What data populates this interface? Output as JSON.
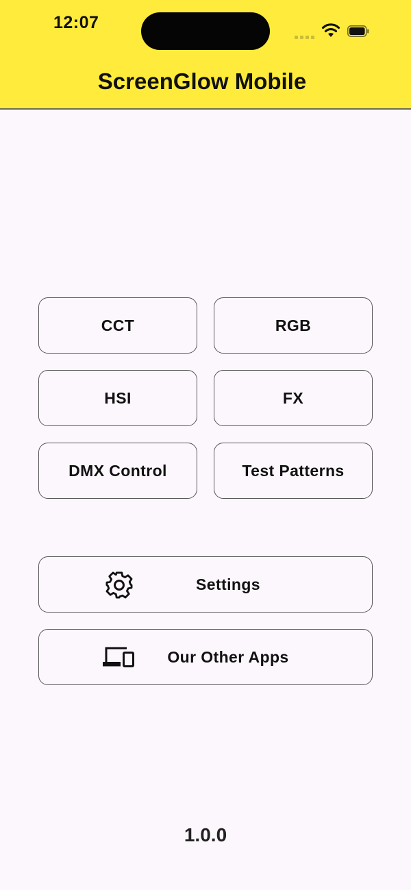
{
  "status_bar": {
    "time": "12:07",
    "icons": [
      "signal-icon",
      "wifi-icon",
      "battery-icon"
    ]
  },
  "header": {
    "title": "ScreenGlow Mobile",
    "background_color": "#ffeb3b"
  },
  "modes": [
    {
      "label": "CCT"
    },
    {
      "label": "RGB"
    },
    {
      "label": "HSI"
    },
    {
      "label": "FX"
    },
    {
      "label": "DMX Control"
    },
    {
      "label": "Test Patterns"
    }
  ],
  "actions": {
    "settings": {
      "label": "Settings",
      "icon": "gear-icon"
    },
    "other_apps": {
      "label": "Our Other Apps",
      "icon": "devices-icon"
    }
  },
  "footer": {
    "version": "1.0.0"
  },
  "colors": {
    "background": "#fcf7fc",
    "accent": "#ffeb3b",
    "border": "#555555"
  }
}
